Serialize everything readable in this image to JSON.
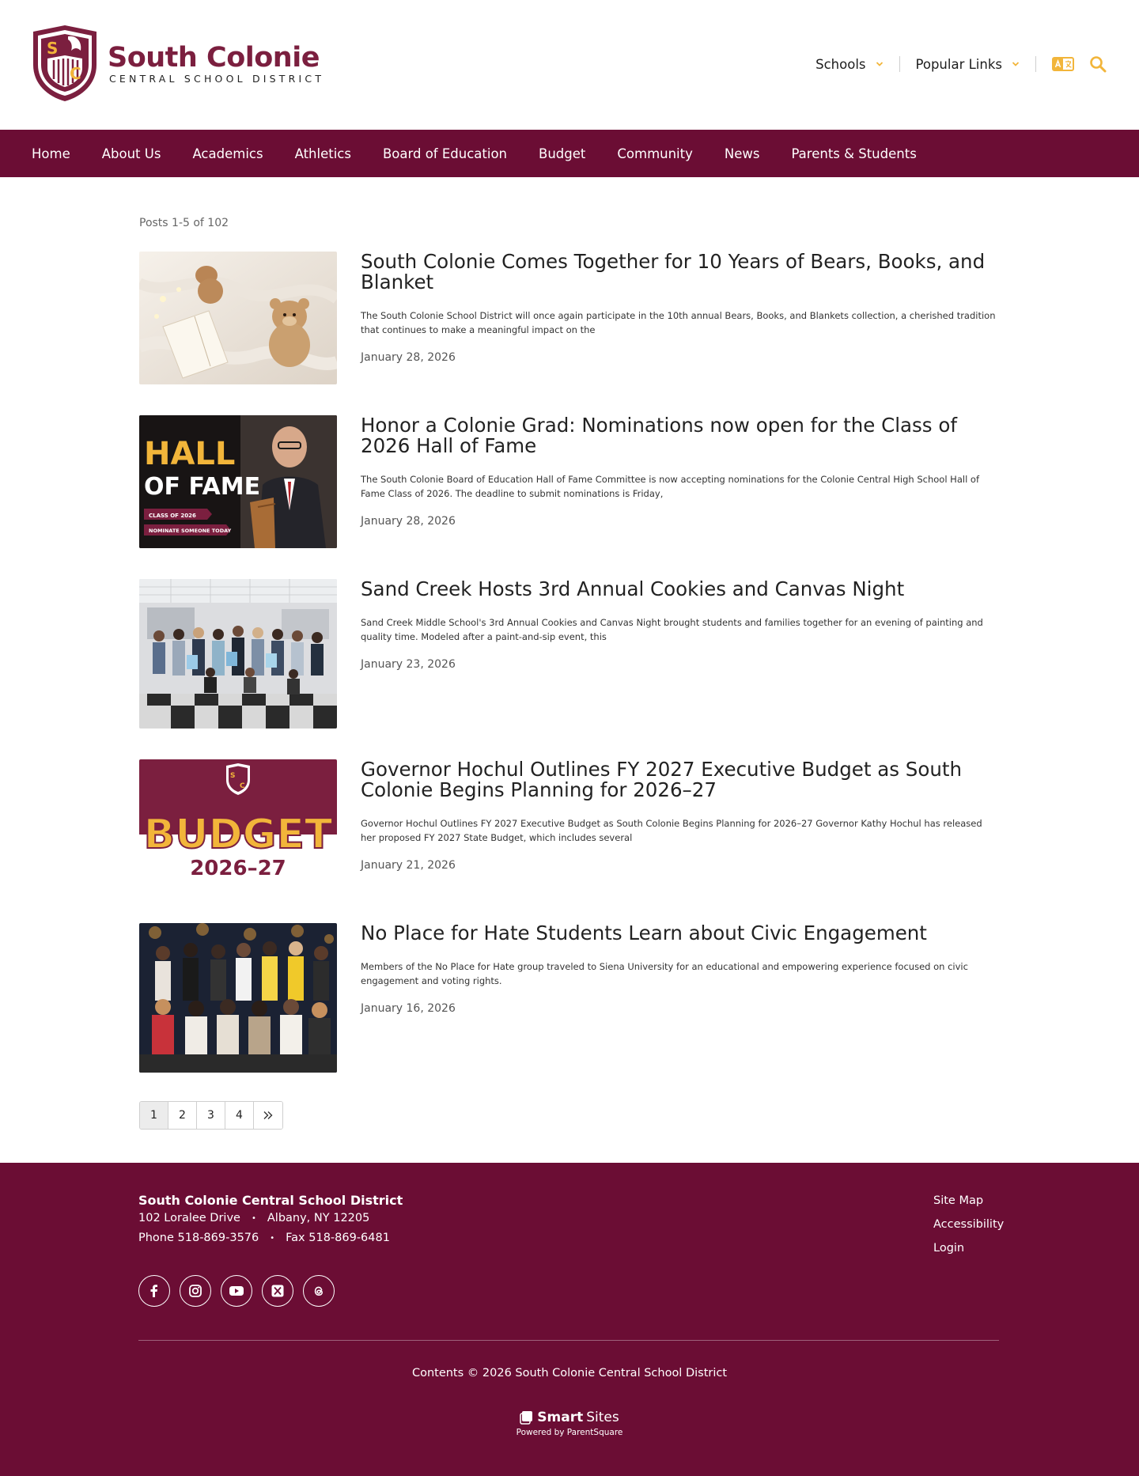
{
  "header": {
    "logo_name": "South Colonie",
    "logo_sub": "CENTRAL SCHOOL DISTRICT",
    "utility": {
      "schools": "Schools",
      "popular_links": "Popular Links"
    }
  },
  "nav": {
    "items": [
      "Home",
      "About Us",
      "Academics",
      "Athletics",
      "Board of Education",
      "Budget",
      "Community",
      "News",
      "Parents & Students"
    ]
  },
  "main": {
    "post_count": "Posts 1-5 of 102",
    "posts": [
      {
        "title": "South Colonie Comes Together for 10 Years of Bears, Books, and Blanket",
        "excerpt": "The South Colonie School District will once again participate in the 10th annual Bears, Books, and Blankets collection, a cherished tradition that continues to make a meaningful impact on the",
        "date": "January 28, 2026"
      },
      {
        "title": "Honor a Colonie Grad: Nominations now open for the Class of 2026 Hall of Fame",
        "excerpt": "The South Colonie Board of Education Hall of Fame Committee is now accepting nominations for the Colonie Central High School Hall of Fame Class of 2026. The deadline to submit nominations is Friday,",
        "date": "January 28, 2026",
        "image_text": {
          "line1": "HALL",
          "line2": "OF FAME",
          "ribbon1": "CLASS OF 2026",
          "ribbon2": "NOMINATE SOMEONE TODAY"
        }
      },
      {
        "title": "Sand Creek Hosts 3rd Annual Cookies and Canvas Night",
        "excerpt": "Sand Creek Middle School's 3rd Annual Cookies and Canvas Night brought students and families together for an evening of painting and quality time. Modeled after a paint-and-sip event, this",
        "date": "January 23, 2026"
      },
      {
        "title": "Governor Hochul Outlines FY 2027 Executive Budget as South Colonie Begins Planning for 2026–27",
        "excerpt": "  Governor Hochul Outlines FY 2027 Executive Budget as South Colonie Begins Planning for 2026–27 Governor Kathy Hochul has released her proposed FY 2027 State Budget, which includes several",
        "date": "January 21, 2026",
        "image_text": {
          "line1": "BUDGET",
          "line2": "2026–27"
        }
      },
      {
        "title": "No Place for Hate Students Learn about Civic Engagement",
        "excerpt": "Members of the No Place for Hate group traveled to Siena University for an educational and empowering experience focused on civic engagement and voting rights.",
        "date": "January 16, 2026"
      }
    ],
    "pagination": [
      "1",
      "2",
      "3",
      "4"
    ],
    "current_page": "1"
  },
  "footer": {
    "org": "South Colonie Central School District",
    "address": "102 Loralee Drive",
    "city": "Albany, NY 12205",
    "phone": "Phone 518-869-3576",
    "fax": "Fax 518-869-6481",
    "links": [
      "Site Map",
      "Accessibility",
      "Login"
    ],
    "copyright": "Contents © 2026 South Colonie Central School District",
    "brand_smart": "Smart",
    "brand_sites": "Sites",
    "powered": "Powered by ParentSquare"
  },
  "colors": {
    "brand": "#6b0d34",
    "logo_maroon": "#7b1f3f",
    "gold": "#f2b53a"
  },
  "icons": [
    "chevron-down-icon",
    "translate-icon",
    "search-icon",
    "facebook-icon",
    "instagram-icon",
    "youtube-icon",
    "x-icon",
    "threads-icon",
    "double-chevron-right-icon"
  ]
}
